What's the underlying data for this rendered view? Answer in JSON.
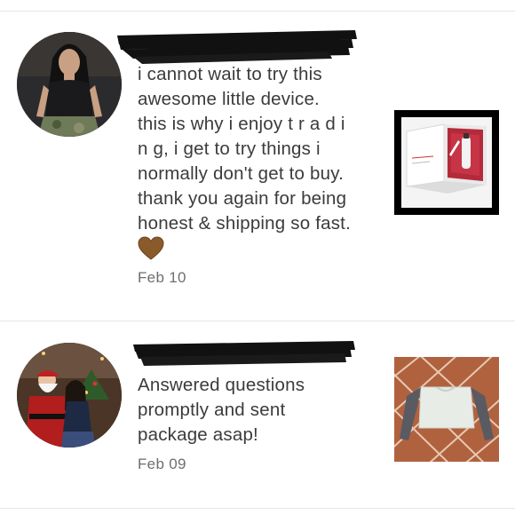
{
  "reviews": [
    {
      "lines": [
        "i cannot wait to try this",
        "awesome little device.",
        "this is why i enjoy t r a d i",
        "n g, i get to try things i",
        "normally don't get to buy.",
        "thank you again for being",
        "honest & shipping so fast."
      ],
      "date": "Feb 10",
      "emoji_icon": "brown-heart-icon",
      "heart_color": "#8a5a2b",
      "avatar_icon": "woman-in-black-top-photo",
      "thumbnail_icon": "white-red-gift-box-photo"
    },
    {
      "lines": [
        "Answered questions",
        "promptly and sent",
        "package asap!"
      ],
      "date": "Feb 09",
      "avatar_icon": "santa-photo",
      "thumbnail_icon": "grey-crop-sweater-photo"
    }
  ],
  "colors": {
    "text": "#3b3b3b",
    "date": "#6e6e6e",
    "divider": "#e6e6e6",
    "redaction": "#111111"
  }
}
